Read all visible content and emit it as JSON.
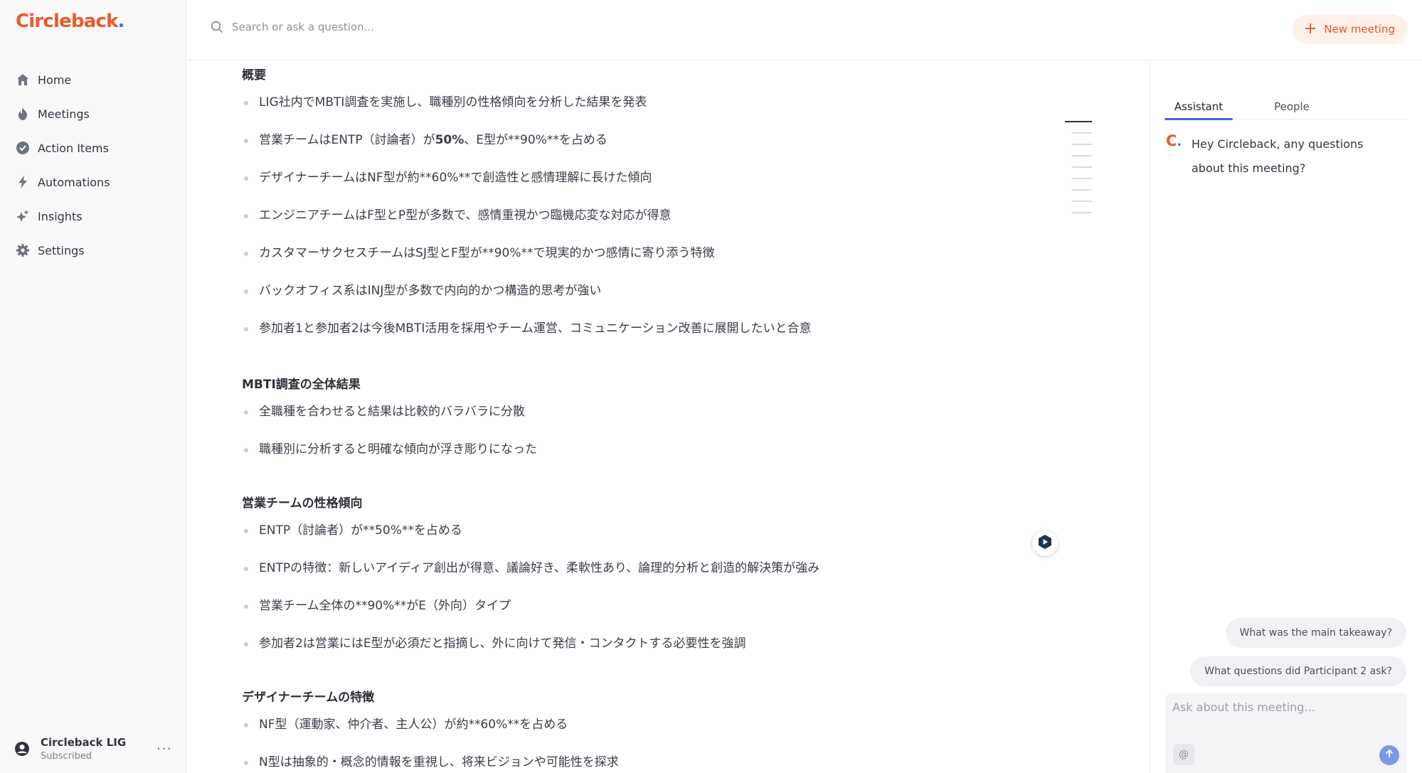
{
  "app": {
    "logo_text": "Circleback",
    "logo_dot": ".",
    "brand_color": "#ea5a2c",
    "accent_color": "#3b6df0"
  },
  "sidebar": {
    "items": [
      {
        "label": "Home",
        "icon": "home-icon"
      },
      {
        "label": "Meetings",
        "icon": "flame-icon"
      },
      {
        "label": "Action Items",
        "icon": "check-circle-icon"
      },
      {
        "label": "Automations",
        "icon": "lightning-icon"
      },
      {
        "label": "Insights",
        "icon": "sparkles-icon"
      },
      {
        "label": "Settings",
        "icon": "gear-icon"
      }
    ],
    "account": {
      "name": "Circleback LIG",
      "status": "Subscribed",
      "more": "···"
    }
  },
  "topbar": {
    "search_placeholder": "Search or ask a question...",
    "new_meeting_label": "New meeting"
  },
  "document": {
    "sections": [
      {
        "title": "概要",
        "bullets": [
          "LIG社内でMBTI調査を実施し、職種別の性格傾向を分析した結果を発表",
          "営業チームはENTP（討論者）が**50%**、E型が**90%**を占める",
          "デザイナーチームはNF型が約**60%**で創造性と感情理解に長けた傾向",
          "エンジニアチームはF型とP型が多数で、感情重視かつ臨機応変な対応が得意",
          "カスタマーサクセスチームはSJ型とF型が**90%**で現実的かつ感情に寄り添う特徴",
          "バックオフィス系はINJ型が多数で内向的かつ構造的思考が強い",
          "参加者1と参加者2は今後MBTI活用を採用やチーム運営、コミュニケーション改善に展開したいと合意"
        ]
      },
      {
        "title": "MBTI調査の全体結果",
        "bullets": [
          "全職種を合わせると結果は比較的バラバラに分散",
          "職種別に分析すると明確な傾向が浮き彫りになった"
        ]
      },
      {
        "title": "営業チームの性格傾向",
        "bullets": [
          "ENTP（討論者）が**50%**を占める",
          "ENTPの特徴：新しいアイディア創出が得意、議論好き、柔軟性あり、論理的分析と創造的解決策が強み",
          "営業チーム全体の**90%**がE（外向）タイプ",
          "参加者2は営業にはE型が必須だと指摘し、外に向けて発信・コンタクトする必要性を強調"
        ]
      },
      {
        "title": "デザイナーチームの特徴",
        "bullets": [
          "NF型（運動家、仲介者、主人公）が約**60%**を占める",
          "N型は抽象的・概念的情報を重視し、将来ビジョンや可能性を探求"
        ]
      }
    ]
  },
  "panel": {
    "tabs": [
      "Assistant",
      "People"
    ],
    "assistant_logo": "C",
    "assistant_message": "Hey Circleback, any questions about this meeting?",
    "suggestions": [
      "What was the main takeaway?",
      "What questions did Participant 2 ask?"
    ],
    "input_placeholder": "Ask about this meeting...",
    "mention_label": "@"
  }
}
